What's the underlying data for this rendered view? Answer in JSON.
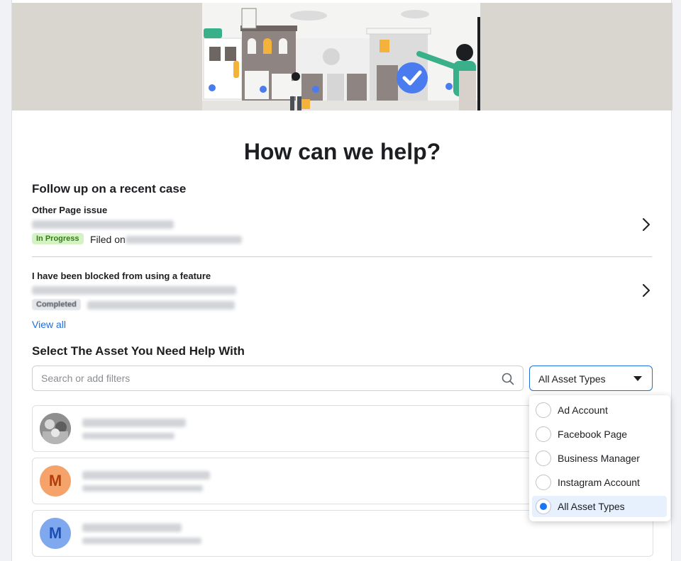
{
  "page": {
    "title": "How can we help?"
  },
  "cases": {
    "heading": "Follow up on a recent case",
    "items": [
      {
        "title": "Other Page issue",
        "status": "In Progress",
        "filed_prefix": "Filed on"
      },
      {
        "title": "I have been blocked from using a feature",
        "status": "Completed"
      }
    ],
    "view_all": "View all"
  },
  "assets": {
    "heading": "Select The Asset You Need Help With",
    "search_placeholder": "Search or add filters",
    "filter_value": "All Asset Types",
    "rows": [
      {
        "avatar": ""
      },
      {
        "avatar": "M"
      },
      {
        "avatar": "M"
      }
    ]
  },
  "dropdown": {
    "options": [
      {
        "label": "Ad Account",
        "selected": false
      },
      {
        "label": "Facebook Page",
        "selected": false
      },
      {
        "label": "Business Manager",
        "selected": false
      },
      {
        "label": "Instagram Account",
        "selected": false
      },
      {
        "label": "All Asset Types",
        "selected": true
      }
    ]
  },
  "colors": {
    "accent": "#1877f2",
    "link": "#216fdb",
    "in_progress_bg": "#d4f3c3",
    "in_progress_text": "#3b7a1e",
    "hero_bg": "#d9d6d0"
  },
  "icons": {
    "search": "search-icon",
    "chevron_right": "chevron-right-icon",
    "caret_down": "caret-down-icon",
    "checkmark": "checkmark-icon"
  }
}
